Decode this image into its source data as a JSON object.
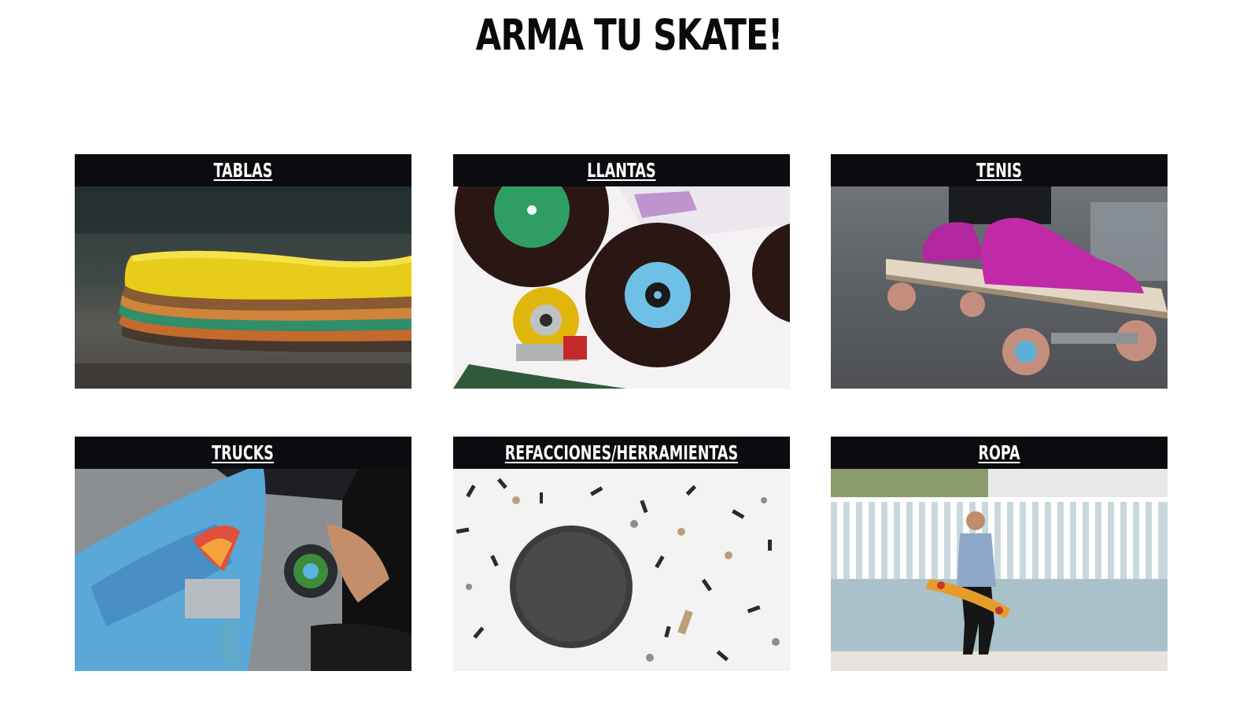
{
  "page": {
    "title": "ARMA TU SKATE!"
  },
  "categories": [
    {
      "label": "TABLAS",
      "image": "stacked-skateboard-decks-photo"
    },
    {
      "label": "LLANTAS",
      "image": "vinyl-records-and-skate-wheel-photo"
    },
    {
      "label": "TENIS",
      "image": "pink-sneakers-on-skateboard-photo"
    },
    {
      "label": "TRUCKS",
      "image": "skateboard-truck-assembly-photo"
    },
    {
      "label": "REFACCIONES/HERRAMIENTAS",
      "image": "screws-and-hardware-photo"
    },
    {
      "label": "ROPA",
      "image": "man-walking-with-skateboard-photo"
    }
  ],
  "colors": {
    "header_bg": "#0b0b10",
    "header_text": "#ffffff",
    "title": "#0a0a0a",
    "background": "#ffffff"
  }
}
